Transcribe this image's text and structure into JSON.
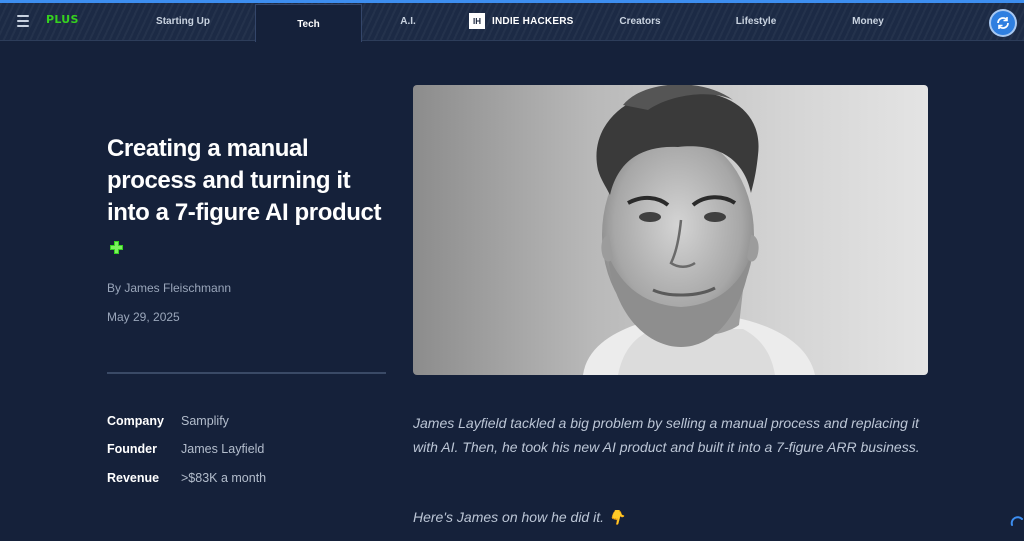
{
  "nav": {
    "brand": "PLUS",
    "tabs": [
      {
        "label": "Starting Up"
      },
      {
        "label": "Tech"
      },
      {
        "label": "A.I."
      },
      {
        "label": "Creators"
      },
      {
        "label": "Lifestyle"
      },
      {
        "label": "Money"
      }
    ],
    "active_tab": "Tech",
    "ih_logo": "IH",
    "ih_name": "INDIE HACKERS"
  },
  "article": {
    "title": "Creating a manual process and turning it into a 7-figure AI product",
    "author": "By James Fleischmann",
    "date": "May 29, 2025",
    "intro": "James Layfield tackled a big problem by selling a manual process and replacing it with AI. Then, he took his new AI product and built it into a 7-figure ARR business.",
    "lead": "Here's James on how he did it. 👇"
  },
  "meta": [
    {
      "key": "Company",
      "value": "Samplify"
    },
    {
      "key": "Founder",
      "value": "James Layfield"
    },
    {
      "key": "Revenue",
      "value": ">$83K a month"
    }
  ],
  "icons": {
    "menu": "menu-icon",
    "plus": "plus-icon",
    "avatar": "avatar-icon",
    "spinner": "loading-spinner-icon"
  },
  "colors": {
    "background": "#15213a",
    "nav": "#1c2a45",
    "accent_green": "#35d21f",
    "accent_blue": "#3d8ef0"
  }
}
